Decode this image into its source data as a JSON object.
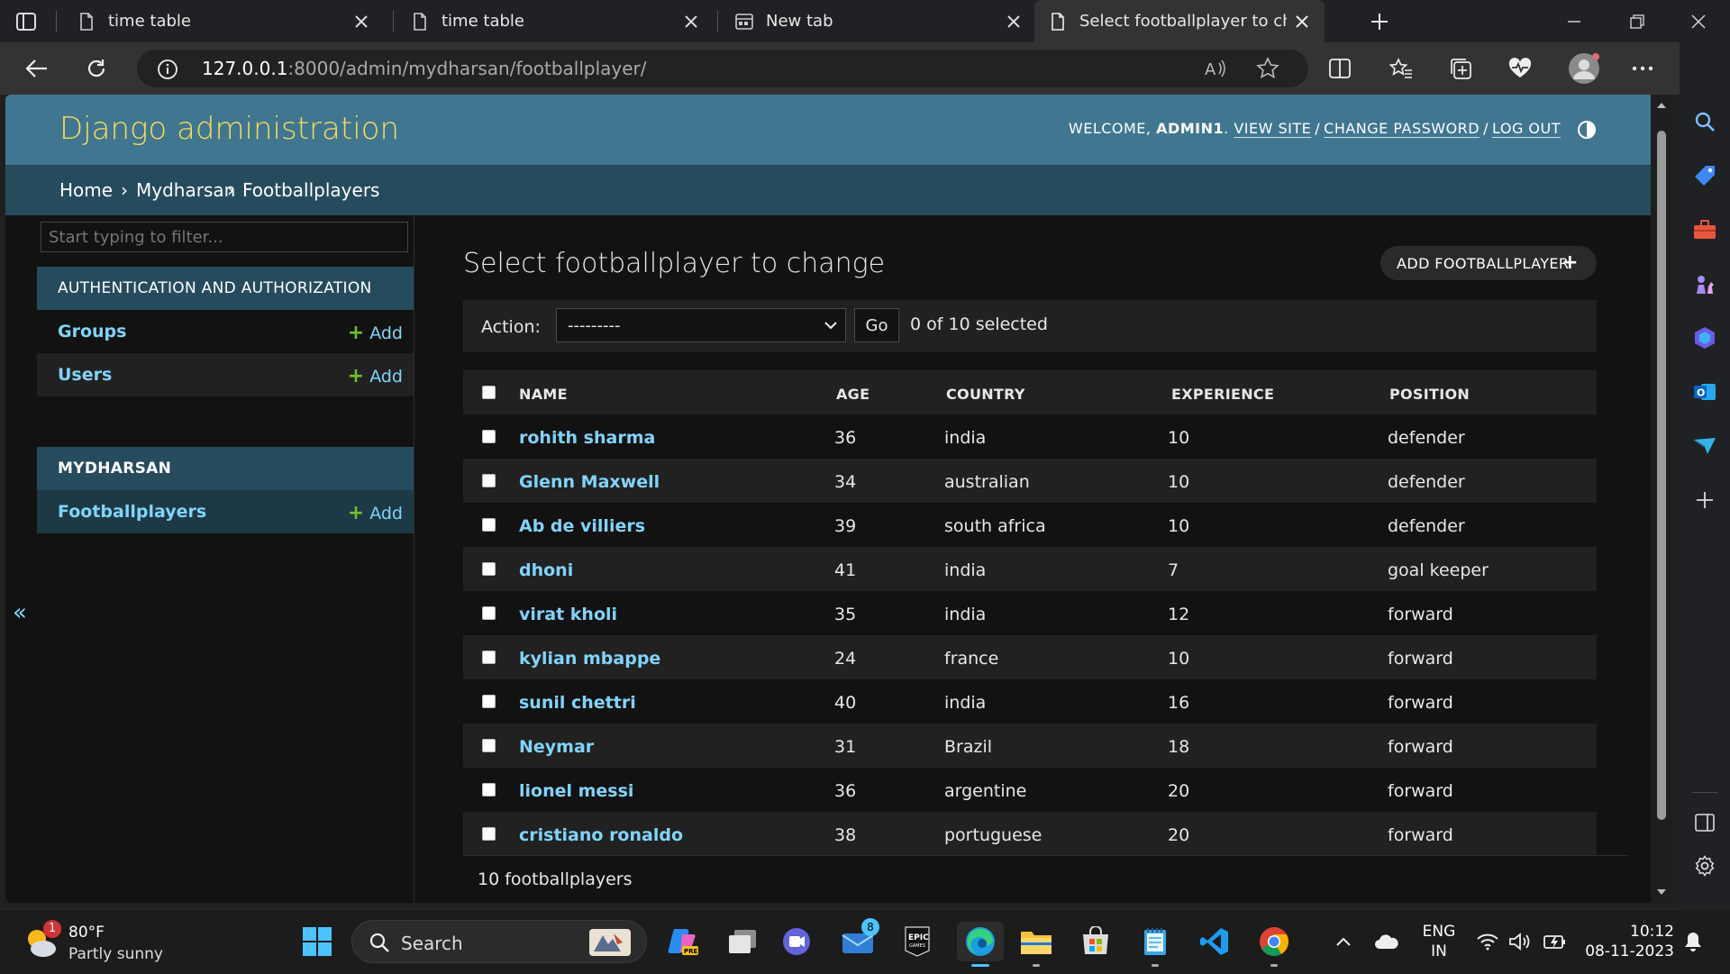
{
  "browser": {
    "tabs": [
      {
        "title": "time table",
        "active": false
      },
      {
        "title": "time table",
        "active": false
      },
      {
        "title": "New tab",
        "active": false
      },
      {
        "title": "Select footballplayer to change |",
        "active": true
      }
    ],
    "url": {
      "host": "127.0.0.1",
      "path": ":8000/admin/mydharsan/footballplayer/"
    }
  },
  "header": {
    "brand": "Django administration",
    "welcome": "WELCOME,",
    "username": "ADMIN1",
    "view_site": "VIEW SITE",
    "change_password": "CHANGE PASSWORD",
    "log_out": "LOG OUT",
    "separator": "/"
  },
  "breadcrumbs": [
    "Home",
    "›",
    "Mydharsan",
    "›",
    "Footballplayers"
  ],
  "nav": {
    "filter_placeholder": "Start typing to filter...",
    "apps": [
      {
        "caption": "AUTHENTICATION AND AUTHORIZATION",
        "models": [
          {
            "name": "Groups",
            "add": "Add"
          },
          {
            "name": "Users",
            "add": "Add"
          }
        ]
      },
      {
        "caption": "MYDHARSAN",
        "models": [
          {
            "name": "Footballplayers",
            "add": "Add"
          }
        ]
      }
    ],
    "collapse": "«"
  },
  "content": {
    "title": "Select footballplayer to change",
    "add_button": "ADD FOOTBALLPLAYER",
    "action_label": "Action:",
    "action_selected": "---------",
    "go": "Go",
    "selection_count": "0 of 10 selected",
    "columns": [
      "NAME",
      "AGE",
      "COUNTRY",
      "EXPERIENCE",
      "POSITION"
    ],
    "rows": [
      [
        "rohith sharma",
        "36",
        "india",
        "10",
        "defender"
      ],
      [
        "Glenn Maxwell",
        "34",
        "australian",
        "10",
        "defender"
      ],
      [
        "Ab de villiers",
        "39",
        "south africa",
        "10",
        "defender"
      ],
      [
        "dhoni",
        "41",
        "india",
        "7",
        "goal keeper"
      ],
      [
        "virat kholi",
        "35",
        "india",
        "12",
        "forward"
      ],
      [
        "kylian mbappe",
        "24",
        "france",
        "10",
        "forward"
      ],
      [
        "sunil chettri",
        "40",
        "india",
        "16",
        "forward"
      ],
      [
        "Neymar",
        "31",
        "Brazil",
        "18",
        "forward"
      ],
      [
        "lionel messi",
        "36",
        "argentine",
        "20",
        "forward"
      ],
      [
        "cristiano ronaldo",
        "38",
        "portuguese",
        "20",
        "forward"
      ]
    ],
    "paginator": "10 footballplayers"
  },
  "taskbar": {
    "weather_badge": "1",
    "temperature": "80°F",
    "condition": "Partly sunny",
    "search": "Search",
    "mail_badge": "8",
    "lang_1": "ENG",
    "lang_2": "IN",
    "time": "10:12",
    "date": "08-11-2023"
  },
  "colors": {
    "header_bg": "#417690",
    "breadcrumb_bg": "#264b5d",
    "brand": "#f5dd5d",
    "link": "#81d4fa",
    "add_green": "#70bf2b"
  }
}
